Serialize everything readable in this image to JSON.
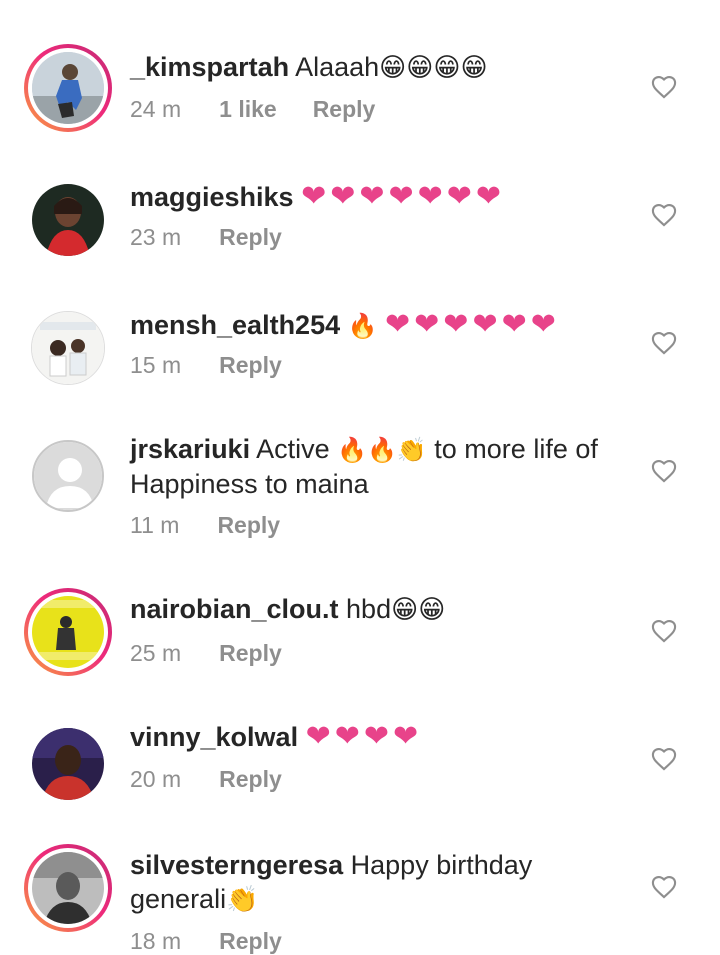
{
  "comments": [
    {
      "username": "_kimspartah",
      "text": " Alaaah",
      "emoji": "😁😁😁😁",
      "time": "24 m",
      "likes": "1 like",
      "reply": "Reply"
    },
    {
      "username": "maggieshiks",
      "text": "",
      "emoji": "❤❤❤❤❤❤❤",
      "time": "23 m",
      "reply": "Reply"
    },
    {
      "username": "mensh_ealth254",
      "text": "",
      "emoji_fire": "🔥",
      "emoji": "❤❤❤❤❤❤",
      "time": "15 m",
      "reply": "Reply"
    },
    {
      "username": "jrskariuki",
      "text_part1": " Active ",
      "emoji_mid": "🔥🔥👏",
      "text_part2": " to more life of",
      "text_line2": "Happiness to maina",
      "time": "11 m",
      "reply": "Reply"
    },
    {
      "username": "nairobian_clou.t",
      "text": " hbd",
      "emoji": "😁😁",
      "time": "25 m",
      "reply": "Reply"
    },
    {
      "username": "vinny_kolwal",
      "text": "",
      "emoji": "❤❤❤❤",
      "time": "20 m",
      "reply": "Reply"
    },
    {
      "username": "silvesterngeresa",
      "text": " Happy birthday",
      "text_line2": "generali",
      "emoji": "👏",
      "time": "18 m",
      "reply": "Reply"
    }
  ],
  "icons": {
    "like": "heart-outline-icon"
  }
}
